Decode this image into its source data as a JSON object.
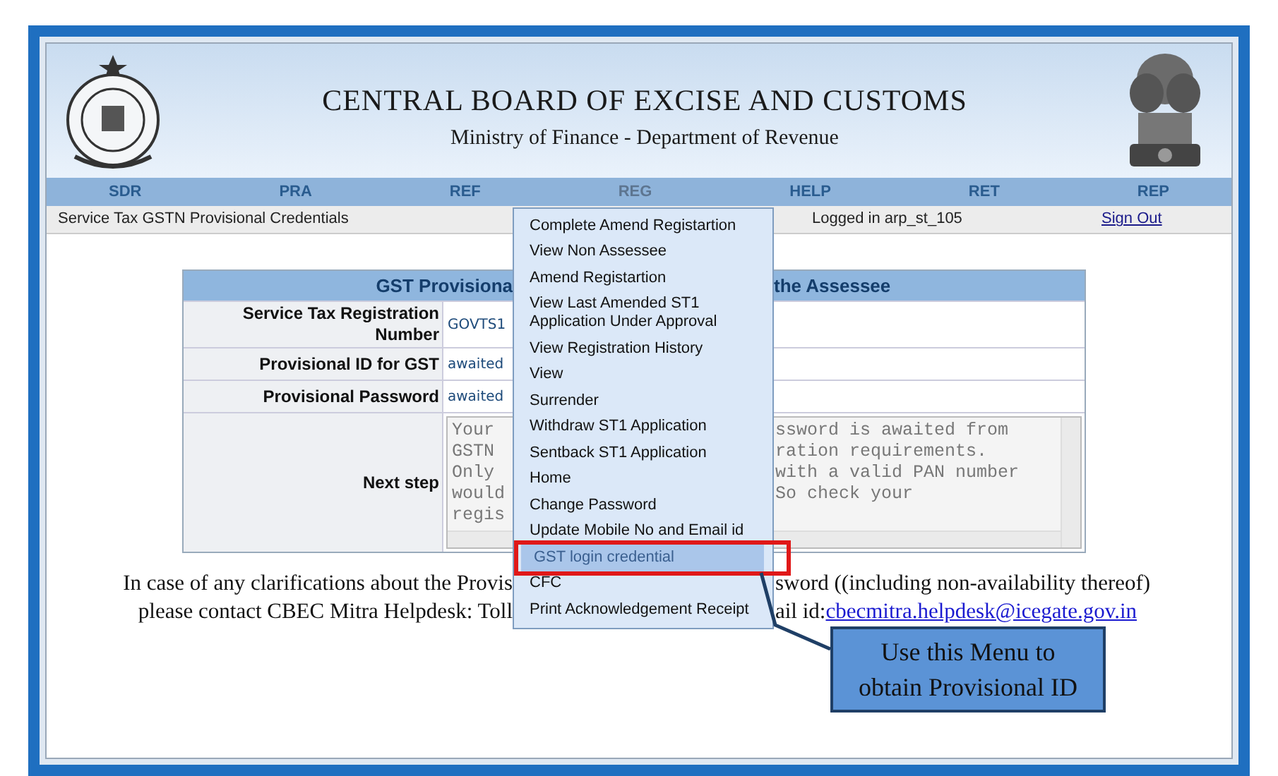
{
  "header": {
    "title": "CENTRAL BOARD OF EXCISE AND CUSTOMS",
    "subtitle": "Ministry of Finance  - Department of Revenue"
  },
  "nav": [
    {
      "label": "SDR",
      "selected": false
    },
    {
      "label": "PRA",
      "selected": false
    },
    {
      "label": "REF",
      "selected": false
    },
    {
      "label": "REG",
      "selected": true
    },
    {
      "label": "HELP",
      "selected": false
    },
    {
      "label": "RET",
      "selected": false
    },
    {
      "label": "REP",
      "selected": false
    }
  ],
  "subbar": {
    "page": "Service Tax GSTN Provisional Credentials",
    "user": "Logged in arp_st_105",
    "sign_out": "Sign Out"
  },
  "table": {
    "title_left": "GST Provisiona",
    "title_right": "the Assessee",
    "rows": [
      {
        "label": "Service Tax Registration Number",
        "value": "GOVTS1"
      },
      {
        "label": "Provisional ID for GST",
        "value": "awaited"
      },
      {
        "label": "Provisional Password",
        "value": "awaited"
      }
    ],
    "next_step": {
      "label": "Next step",
      "lines": [
        {
          "left": "Your",
          "right": "ssword is awaited from"
        },
        {
          "left": "GSTN",
          "right": "ration requirements."
        },
        {
          "left": "Only",
          "right": "with a valid PAN number"
        },
        {
          "left": "would",
          "right": "So check your"
        },
        {
          "left": "regis"
        }
      ]
    }
  },
  "notice": [
    {
      "left": "In case of any clarifications about the Provis",
      "right": "sword ((including non-availability thereof)"
    },
    {
      "left": "please contact CBEC Mitra Helpdesk: Toll",
      "right": "ail id:",
      "link": "cbecmitra.helpdesk@icegate.gov.in"
    }
  ],
  "menu": [
    {
      "label": "Complete Amend Registartion",
      "selected": false,
      "circled": false
    },
    {
      "label": "View Non Assessee",
      "selected": false,
      "circled": false
    },
    {
      "label": "Amend Registartion",
      "selected": false,
      "circled": false
    },
    {
      "label": "View Last Amended ST1 Application Under Approval",
      "selected": false,
      "circled": false
    },
    {
      "label": "View Registration History",
      "selected": false,
      "circled": false
    },
    {
      "label": "View",
      "selected": false,
      "circled": false
    },
    {
      "label": "Surrender",
      "selected": false,
      "circled": false
    },
    {
      "label": "Withdraw ST1 Application",
      "selected": false,
      "circled": false
    },
    {
      "label": "Sentback ST1 Application",
      "selected": false,
      "circled": false
    },
    {
      "label": "Home",
      "selected": false,
      "circled": false
    },
    {
      "label": "Change Password",
      "selected": false,
      "circled": false
    },
    {
      "label": "Update Mobile No and Email id",
      "selected": false,
      "circled": false
    },
    {
      "label": "GST login credential",
      "selected": true,
      "circled": true
    },
    {
      "label": "CFC",
      "selected": false,
      "circled": false
    },
    {
      "label": "Print Acknowledgement Receipt",
      "selected": false,
      "circled": false
    }
  ],
  "callout": "Use this Menu to obtain Provisional ID"
}
